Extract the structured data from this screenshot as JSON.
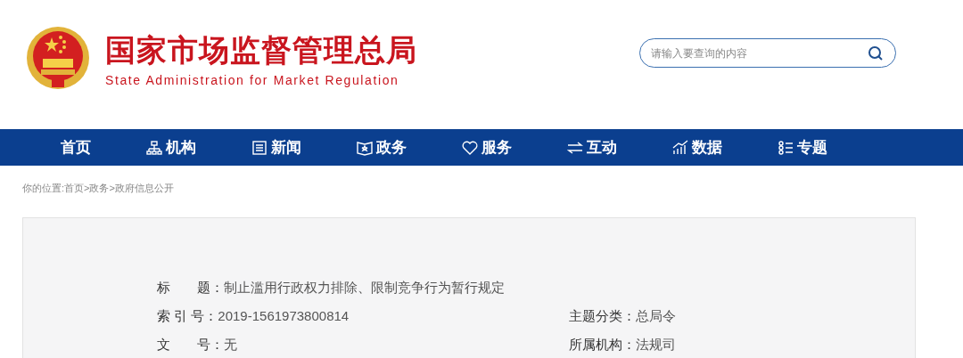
{
  "header": {
    "title": "国家市场监督管理总局",
    "subtitle": "State Administration for Market Regulation"
  },
  "search": {
    "placeholder": "请输入要查询的内容"
  },
  "nav": [
    {
      "label": "首页"
    },
    {
      "label": "机构"
    },
    {
      "label": "新闻"
    },
    {
      "label": "政务"
    },
    {
      "label": "服务"
    },
    {
      "label": "互动"
    },
    {
      "label": "数据"
    },
    {
      "label": "专题"
    }
  ],
  "breadcrumb": "你的位置:首页>政务>政府信息公开",
  "info": {
    "title_row": {
      "label": "标　　题：",
      "value": "制止滥用行政权力排除、限制竞争行为暂行规定"
    },
    "rows": [
      {
        "left": {
          "label": "索 引 号：",
          "value": "2019-1561973800814"
        },
        "right": {
          "label": "主题分类：",
          "value": "总局令"
        }
      },
      {
        "left": {
          "label": "文　　号：",
          "value": "无"
        },
        "right": {
          "label": "所属机构：",
          "value": "法规司"
        }
      }
    ]
  }
}
